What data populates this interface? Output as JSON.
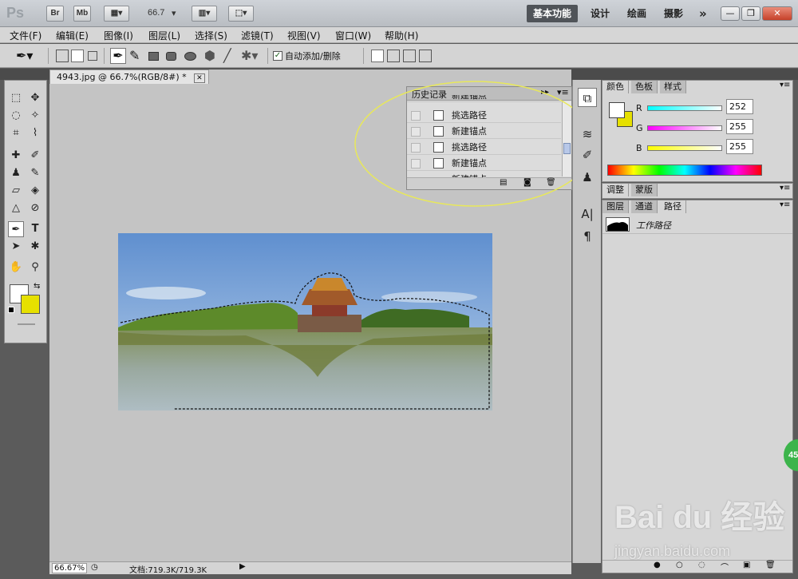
{
  "titlebar": {
    "logo": "Ps",
    "bridge_btn": "Br",
    "minibridge_btn": "Mb",
    "zoom_value": "66.7",
    "workspaces": [
      "基本功能",
      "设计",
      "绘画",
      "摄影"
    ],
    "more": "»",
    "win_controls": [
      "—",
      "❐",
      "✕"
    ]
  },
  "menu": [
    "文件(F)",
    "编辑(E)",
    "图像(I)",
    "图层(L)",
    "选择(S)",
    "滤镜(T)",
    "视图(V)",
    "窗口(W)",
    "帮助(H)"
  ],
  "options": {
    "auto_add_delete_label": "自动添加/删除",
    "auto_add_delete_checked": true
  },
  "document": {
    "tab_title": "4943.jpg @ 66.7%(RGB/8#) *",
    "tab_close": "✕",
    "status_zoom": "66.67%",
    "status_doc": "文档:719.3K/719.3K"
  },
  "history": {
    "title": "历史记录",
    "items": [
      "新建锚点",
      "挑选路径",
      "新建锚点",
      "挑选路径",
      "新建锚点",
      "新建锚点"
    ]
  },
  "color_panel": {
    "tabs": [
      "颜色",
      "色板",
      "样式"
    ],
    "r_label": "R",
    "g_label": "G",
    "b_label": "B",
    "r": "252",
    "g": "255",
    "b": "255",
    "foreground": "#ffffff",
    "background": "#e6e000"
  },
  "adjust_panel": {
    "tabs": [
      "调整",
      "蒙版"
    ]
  },
  "paths_panel": {
    "tabs": [
      "图层",
      "通道",
      "路径"
    ],
    "items": [
      "工作路径"
    ]
  },
  "watermark": {
    "brand": "Bai du 经验",
    "url": "jingyan.baidu.com"
  },
  "badge": "45"
}
